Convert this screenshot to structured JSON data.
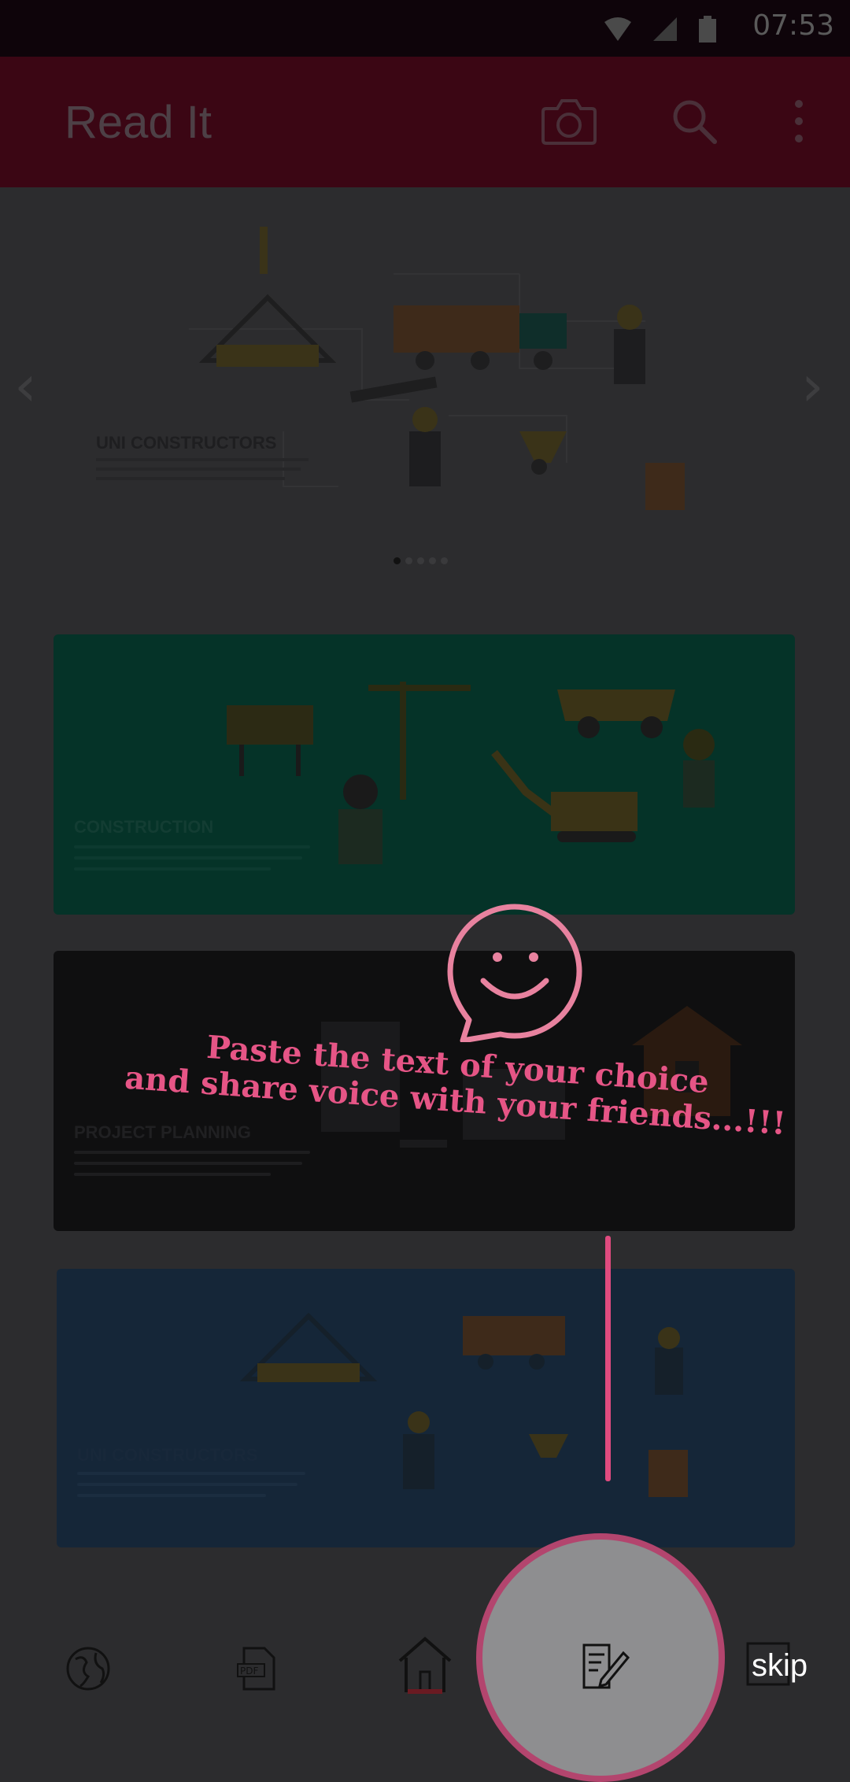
{
  "status_bar": {
    "time": "07:53",
    "icons": [
      "wifi-icon",
      "signal-icon",
      "battery-icon"
    ]
  },
  "app_bar": {
    "title": "Read It",
    "actions": [
      "camera-icon",
      "search-icon",
      "overflow-menu-icon"
    ]
  },
  "carousel": {
    "slide_title": "UNI CONSTRUCTORS",
    "page_count": 5,
    "active_index": 0
  },
  "cards": [
    {
      "title": "CONSTRUCTION"
    },
    {
      "title": "PROJECT PLANNING"
    },
    {
      "title": "UNI CONSTRUCTORS"
    }
  ],
  "tutorial": {
    "line1": "Paste the text of your choice",
    "line2": "and share voice with your friends...!!!",
    "icon": "smiley-chat-icon",
    "skip_label": "skip"
  },
  "bottom_nav": [
    {
      "name": "globe",
      "icon": "globe-icon"
    },
    {
      "name": "pdf",
      "icon": "pdf-icon",
      "label": "PDF"
    },
    {
      "name": "home",
      "icon": "home-icon"
    },
    {
      "name": "text-editor",
      "icon": "edit-document-icon"
    },
    {
      "name": "image",
      "icon": "image-icon"
    }
  ],
  "colors": {
    "accent": "#e65586",
    "appbar": "#3b0614",
    "dim_bg": "#2c2c2e"
  }
}
